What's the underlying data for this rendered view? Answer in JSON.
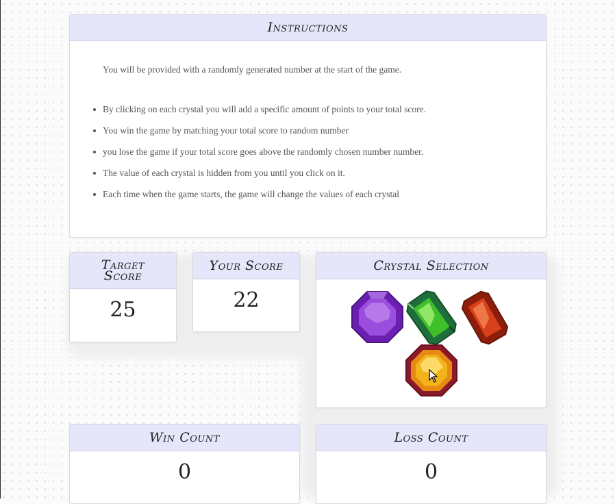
{
  "instructions": {
    "title": "Instructions",
    "intro": "You will be provided with a randomly generated number at the start of the game.",
    "items": [
      "By clicking on each crystal you will add a specific amount of points to your total score.",
      "You win the game by matching your total score to random number",
      "you lose the game if your total score goes above the randomly chosen number number.",
      "The value of each crystal is hidden from you until you click on it.",
      "Each time when the game starts, the game will change the values of each crystal"
    ]
  },
  "target": {
    "title_line1": "Target",
    "title_line2": "Score",
    "value": "25"
  },
  "score": {
    "title": "Your Score",
    "value": "22"
  },
  "crystals": {
    "title": "Crystal Selection",
    "items": [
      {
        "name": "purple-crystal",
        "color": "#8a2be2"
      },
      {
        "name": "green-crystal",
        "color": "#3fbf2a"
      },
      {
        "name": "red-crystal",
        "color": "#d8401c"
      },
      {
        "name": "yellow-crystal",
        "color": "#f2b21a"
      }
    ]
  },
  "wins": {
    "title": "Win Count",
    "value": "0"
  },
  "losses": {
    "title": "Loss Count",
    "value": "0"
  }
}
